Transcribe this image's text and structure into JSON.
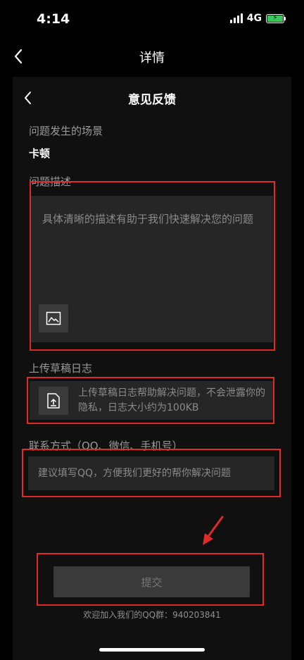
{
  "status_bar": {
    "time": "4:14",
    "network": "4G",
    "battery_charging": true
  },
  "nav": {
    "title": "详情"
  },
  "feedback": {
    "title": "意见反馈",
    "scene_label": "问题发生的场景",
    "scene_value": "卡顿",
    "description_label": "问题描述",
    "description_placeholder": "具体清晰的描述有助于我们快速解决您的问题",
    "upload_label": "上传草稿日志",
    "upload_text": "上传草稿日志帮助解决问题，不会泄露你的隐私，日志大小约为100KB",
    "contact_label": "联系方式（QQ、微信、手机号）",
    "contact_placeholder": "建议填写QQ，方便我们更好的帮你解决问题",
    "submit_label": "提交",
    "qq_group_text": "欢迎加入我们的QQ群：940203841"
  },
  "colors": {
    "annotation_red": "#e02a2a",
    "charging_green": "#35c759"
  }
}
